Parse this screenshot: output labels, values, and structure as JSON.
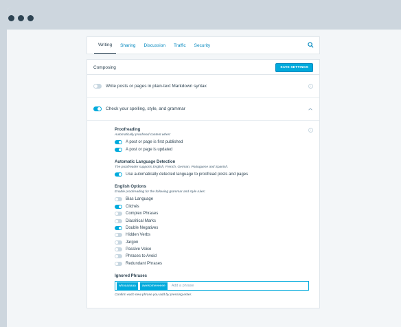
{
  "tabs": [
    {
      "label": "Writing"
    },
    {
      "label": "Sharing"
    },
    {
      "label": "Discussion"
    },
    {
      "label": "Traffic"
    },
    {
      "label": "Security"
    }
  ],
  "composing": {
    "title": "Composing",
    "save_label": "SAVE SETTINGS"
  },
  "markdown": {
    "label": "Write posts or pages in plain-text Markdown syntax",
    "on": false
  },
  "spelling": {
    "label": "Check your spelling, style, and grammar",
    "on": true
  },
  "proofreading": {
    "title": "Proofreading",
    "desc": "Automatically proofread content when:",
    "options": [
      {
        "label": "A post or page is first published",
        "on": true
      },
      {
        "label": "A post or page is updated",
        "on": true
      }
    ]
  },
  "language": {
    "title": "Automatic Language Detection",
    "desc": "The proofreader supports English, French, German, Portuguese and Spanish.",
    "option": {
      "label": "Use automatically detected language to proofread posts and pages",
      "on": true
    }
  },
  "english": {
    "title": "English Options",
    "desc": "Enable proofreading for the following grammar and style rules:",
    "options": [
      {
        "label": "Bias Language",
        "on": false
      },
      {
        "label": "Clichés",
        "on": true
      },
      {
        "label": "Complex Phrases",
        "on": false
      },
      {
        "label": "Diacritical Marks",
        "on": false
      },
      {
        "label": "Double Negatives",
        "on": true
      },
      {
        "label": "Hidden Verbs",
        "on": false
      },
      {
        "label": "Jargon",
        "on": false
      },
      {
        "label": "Passive Voice",
        "on": false
      },
      {
        "label": "Phrases to Avoid",
        "on": false
      },
      {
        "label": "Redundant Phrases",
        "on": false
      }
    ]
  },
  "ignored": {
    "title": "Ignored Phrases",
    "chips": [
      "whoaaaaaa",
      "awesomeeeeee"
    ],
    "placeholder": "Add a phrase",
    "hint": "Confirm each new phrase you add by pressing enter."
  },
  "colors": {
    "accent": "#00aadc",
    "text": "#2e4453",
    "link": "#0087be"
  }
}
